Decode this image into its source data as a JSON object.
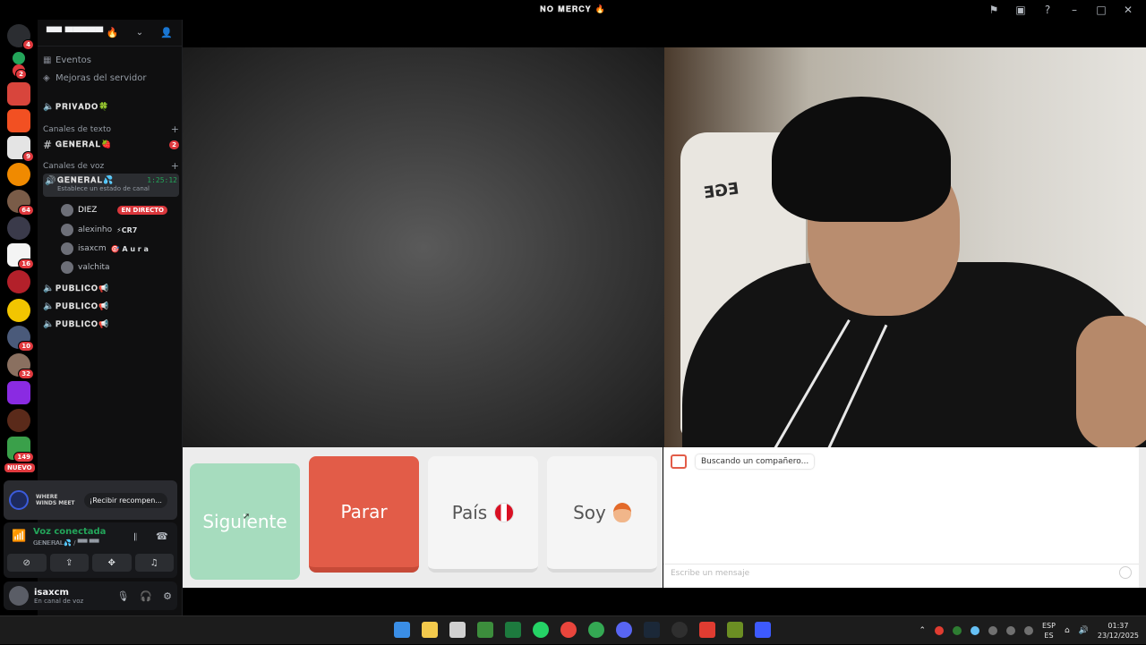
{
  "window": {
    "title": "𝐍𝐎 𝐌𝐄𝐑𝐂𝐘 🔥"
  },
  "server": {
    "name": "▀▀ ▀▀▀▀▀ 🔥",
    "menu": [
      {
        "label": "Eventos",
        "icon": "calendar-icon"
      },
      {
        "label": "Mejoras del servidor",
        "icon": "boost-icon"
      }
    ],
    "private_channel": "𝐏𝐑𝐈𝐕𝐀𝐃𝐎🍀",
    "text_category": "Canales de texto",
    "text_channel": {
      "name": "𝐆𝐄𝐍𝐄𝐑𝐀𝐋🍓",
      "badge": "2"
    },
    "voice_category": "Canales de voz",
    "voice_channel": {
      "name": "𝐆𝐄𝐍𝐄𝐑𝐀𝐋💦",
      "timer": "1:25:12",
      "status_hint": "Establece un estado de canal"
    },
    "voice_users": [
      {
        "name": "DIEZ",
        "extra": "",
        "live": "EN DIRECTO"
      },
      {
        "name": "alexinho",
        "extra": "⚡CR7",
        "live": ""
      },
      {
        "name": "isaxcm",
        "extra": "🎯 A u r a",
        "live": ""
      },
      {
        "name": "valchita",
        "extra": "",
        "live": ""
      }
    ],
    "public_channels": [
      "𝐏𝐔𝐁𝐋𝐈𝐂𝐎📢",
      "𝐏𝐔𝐁𝐋𝐈𝐂𝐎📢",
      "𝐏𝐔𝐁𝐋𝐈𝐂𝐎📢"
    ]
  },
  "rail": {
    "badges": [
      "4",
      "2",
      "9",
      "64",
      "16",
      "10",
      "32",
      "149"
    ],
    "new_label": "NUEVO"
  },
  "promo": {
    "brand": "WHERE WINDS MEET",
    "button": "¡Recibir recompen..."
  },
  "voice_panel": {
    "status": "Voz conectada",
    "sub": "𝐆𝐄𝐍𝐄𝐑𝐀𝐋💦 / ▀▀ ▀▀"
  },
  "user": {
    "name": "isaxcm",
    "status": "En canal de voz"
  },
  "app": {
    "buttons": {
      "next": "Siguiente",
      "stop": "Parar",
      "country": "País",
      "soy": "Soy"
    },
    "chat": {
      "message": "Buscando un compañero...",
      "placeholder": "Escribe un mensaje"
    },
    "chair_text": "EGE"
  },
  "taskbar": {
    "lang_top": "ESP",
    "lang_bottom": "ES",
    "time": "01:37",
    "date": "23/12/2025"
  },
  "colors": {
    "stop": "#e25c48",
    "next": "#a6dcbe",
    "voice_green": "#23a55a",
    "badge_red": "#e0393e"
  }
}
